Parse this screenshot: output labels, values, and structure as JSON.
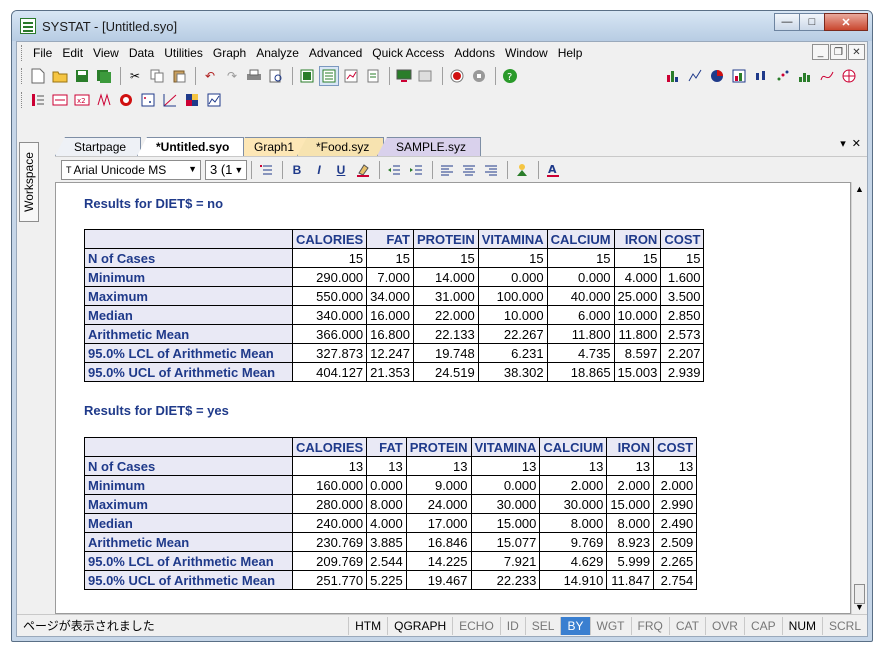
{
  "window": {
    "title": "SYSTAT - [Untitled.syo]"
  },
  "menu": [
    "File",
    "Edit",
    "View",
    "Data",
    "Utilities",
    "Graph",
    "Analyze",
    "Advanced",
    "Quick Access",
    "Addons",
    "Window",
    "Help"
  ],
  "workspace_label": "Workspace",
  "tabs": [
    {
      "label": "Startpage",
      "color": "#eef1f6"
    },
    {
      "label": "*Untitled.syo",
      "color": "#ffffff"
    },
    {
      "label": "Graph1",
      "color": "#fde7b6"
    },
    {
      "label": "*Food.syz",
      "color": "#f7e3b0"
    },
    {
      "label": "SAMPLE.syz",
      "color": "#d9d1ec"
    }
  ],
  "format": {
    "font": "Arial Unicode MS",
    "size": "3 (1"
  },
  "sections": [
    {
      "title": "Results for DIET$ = no",
      "columns": [
        "CALORIES",
        "FAT",
        "PROTEIN",
        "VITAMINA",
        "CALCIUM",
        "IRON",
        "COST"
      ],
      "rows": [
        {
          "label": "N of Cases",
          "values": [
            "15",
            "15",
            "15",
            "15",
            "15",
            "15",
            "15"
          ]
        },
        {
          "label": "Minimum",
          "values": [
            "290.000",
            "7.000",
            "14.000",
            "0.000",
            "0.000",
            "4.000",
            "1.600"
          ]
        },
        {
          "label": "Maximum",
          "values": [
            "550.000",
            "34.000",
            "31.000",
            "100.000",
            "40.000",
            "25.000",
            "3.500"
          ]
        },
        {
          "label": "Median",
          "values": [
            "340.000",
            "16.000",
            "22.000",
            "10.000",
            "6.000",
            "10.000",
            "2.850"
          ]
        },
        {
          "label": "Arithmetic Mean",
          "values": [
            "366.000",
            "16.800",
            "22.133",
            "22.267",
            "11.800",
            "11.800",
            "2.573"
          ]
        },
        {
          "label": "95.0% LCL of Arithmetic Mean",
          "values": [
            "327.873",
            "12.247",
            "19.748",
            "6.231",
            "4.735",
            "8.597",
            "2.207"
          ]
        },
        {
          "label": "95.0% UCL of Arithmetic Mean",
          "values": [
            "404.127",
            "21.353",
            "24.519",
            "38.302",
            "18.865",
            "15.003",
            "2.939"
          ]
        }
      ]
    },
    {
      "title": "Results for DIET$ = yes",
      "columns": [
        "CALORIES",
        "FAT",
        "PROTEIN",
        "VITAMINA",
        "CALCIUM",
        "IRON",
        "COST"
      ],
      "rows": [
        {
          "label": "N of Cases",
          "values": [
            "13",
            "13",
            "13",
            "13",
            "13",
            "13",
            "13"
          ]
        },
        {
          "label": "Minimum",
          "values": [
            "160.000",
            "0.000",
            "9.000",
            "0.000",
            "2.000",
            "2.000",
            "2.000"
          ]
        },
        {
          "label": "Maximum",
          "values": [
            "280.000",
            "8.000",
            "24.000",
            "30.000",
            "30.000",
            "15.000",
            "2.990"
          ]
        },
        {
          "label": "Median",
          "values": [
            "240.000",
            "4.000",
            "17.000",
            "15.000",
            "8.000",
            "8.000",
            "2.490"
          ]
        },
        {
          "label": "Arithmetic Mean",
          "values": [
            "230.769",
            "3.885",
            "16.846",
            "15.077",
            "9.769",
            "8.923",
            "2.509"
          ]
        },
        {
          "label": "95.0% LCL of Arithmetic Mean",
          "values": [
            "209.769",
            "2.544",
            "14.225",
            "7.921",
            "4.629",
            "5.999",
            "2.265"
          ]
        },
        {
          "label": "95.0% UCL of Arithmetic Mean",
          "values": [
            "251.770",
            "5.225",
            "19.467",
            "22.233",
            "14.910",
            "11.847",
            "2.754"
          ]
        }
      ]
    }
  ],
  "status": {
    "message": "ページが表示されました",
    "indicators": [
      {
        "label": "HTM",
        "state": "on"
      },
      {
        "label": "QGRAPH",
        "state": "on"
      },
      {
        "label": "ECHO",
        "state": "off"
      },
      {
        "label": "ID",
        "state": "off"
      },
      {
        "label": "SEL",
        "state": "off"
      },
      {
        "label": "BY",
        "state": "selected"
      },
      {
        "label": "WGT",
        "state": "off"
      },
      {
        "label": "FRQ",
        "state": "off"
      },
      {
        "label": "CAT",
        "state": "off"
      },
      {
        "label": "OVR",
        "state": "off"
      },
      {
        "label": "CAP",
        "state": "off"
      },
      {
        "label": "NUM",
        "state": "on"
      },
      {
        "label": "SCRL",
        "state": "off"
      }
    ]
  }
}
